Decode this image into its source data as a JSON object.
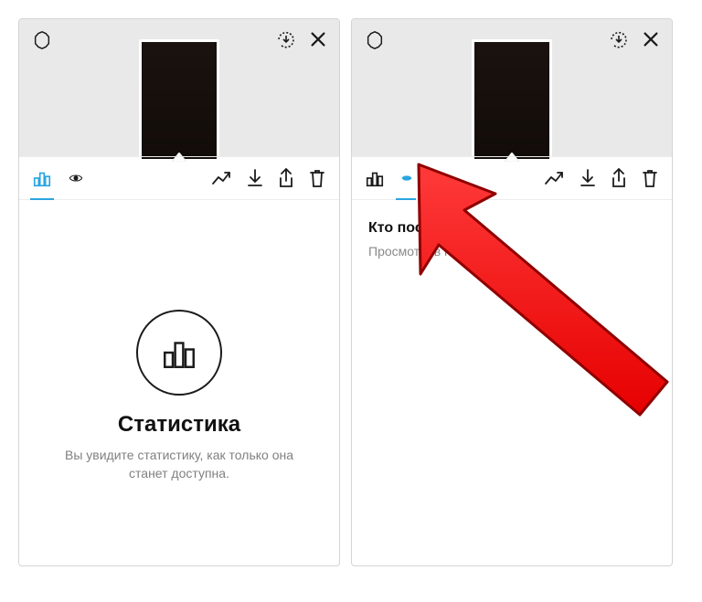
{
  "colors": {
    "accent": "#2aa5e0",
    "arrow": "#ff1b1b",
    "arrowStroke": "#990000"
  },
  "left_screen": {
    "tab_selected": "stats",
    "stats": {
      "title": "Статистика",
      "subtitle": "Вы увидите статистику, как только она станет доступна."
    }
  },
  "right_screen": {
    "tab_selected": "views",
    "views": {
      "title": "Кто посмо",
      "subtitle": "Просмотров п"
    }
  }
}
